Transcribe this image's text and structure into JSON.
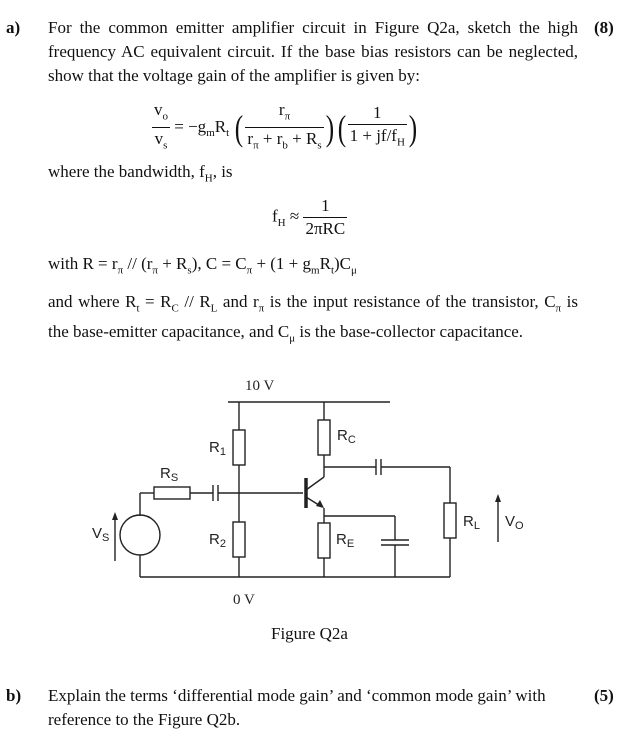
{
  "part_a": {
    "label": "a)",
    "marks": "(8)",
    "intro": "For the common emitter amplifier circuit in Figure Q2a, sketch the high frequency AC equivalent circuit. If the base bias resistors can be neglected, show that the voltage gain of the amplifier is given by:",
    "gain_equation": {
      "lhs_num": "v",
      "lhs_num_sub": "o",
      "lhs_den": "v",
      "lhs_den_sub": "s",
      "eq_prefix": "= −g",
      "gm_sub": "m",
      "rt": "R",
      "rt_sub": "t",
      "frac1_num": "r",
      "frac1_num_sub": "π",
      "frac1_den_parts": [
        "r",
        "π",
        " + r",
        "b",
        " + R",
        "s"
      ],
      "frac2_num": "1",
      "frac2_den": "1 + jf/f",
      "frac2_den_sub": "H"
    },
    "bandwidth_text_before": "where the bandwidth,  f",
    "bandwidth_text_sub": "H",
    "bandwidth_text_after": ", is",
    "fh_equation": {
      "lhs": "f",
      "lhs_sub": "H",
      "approx": " ≈ ",
      "num": "1",
      "den": "2πRC"
    },
    "with_line": {
      "text1": "with  R = r",
      "sub1": "π",
      "text2": "  //  (r",
      "sub2": "π",
      "text3": " + R",
      "sub3": "s",
      "text4": "),  C = C",
      "sub4": "π",
      "text5": " + (1 + g",
      "sub5": "m",
      "text6": "R",
      "sub6": "t",
      "text7": ")C",
      "sub7": "μ"
    },
    "where_para": {
      "t1": "and where R",
      "s1": "t",
      "t2": " = R",
      "s2": "C",
      "t3": " // R",
      "s3": "L",
      "t4": " and r",
      "s4": "π",
      "t5": " is the input resistance of the transistor, C",
      "s5": "π",
      "t6": " is the base-emitter capacitance, and C",
      "s6": "μ",
      "t7": " is the base-collector capacitance."
    },
    "figure": {
      "caption": "Figure Q2a",
      "supply_label": "10 V",
      "ground_label": "0 V",
      "labels": {
        "rs": "R",
        "rs_sub": "S",
        "r1": "R",
        "r1_sub": "1",
        "r2": "R",
        "r2_sub": "2",
        "rc": "R",
        "rc_sub": "C",
        "re": "R",
        "re_sub": "E",
        "rl": "R",
        "rl_sub": "L",
        "vs": "V",
        "vs_sub": "S",
        "vo": "V",
        "vo_sub": "O"
      }
    }
  },
  "part_b": {
    "label": "b)",
    "marks": "(5)",
    "text": "Explain the terms ‘differential mode gain’ and ‘common mode gain’ with reference to the Figure Q2b."
  }
}
